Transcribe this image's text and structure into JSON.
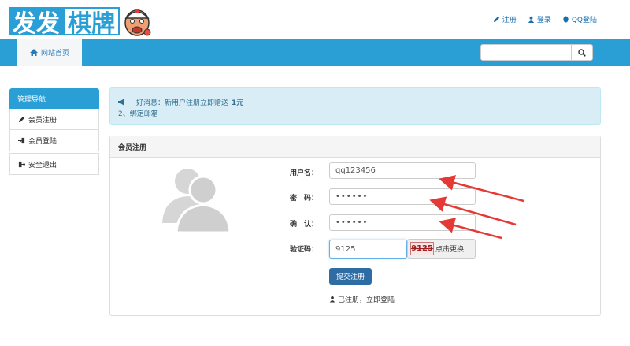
{
  "header": {
    "logo_text_1": "发发",
    "logo_text_2": "棋牌",
    "links": {
      "register": "注册",
      "login": "登录",
      "qq_login": "QQ登陆"
    }
  },
  "nav": {
    "home": "网站首页",
    "search_placeholder": ""
  },
  "sidebar": {
    "title": "管理导航",
    "items": [
      "会员注册",
      "会员登陆",
      "安全退出"
    ]
  },
  "notice": {
    "line1_prefix": "好消息：新用户注册立即赠送",
    "line1_bold": "1元",
    "line2": "2、绑定邮箱"
  },
  "panel": {
    "title": "会员注册",
    "username_label": "用户名：",
    "username_value": "qq123456",
    "password_label": "密　码：",
    "password_value": "••••••",
    "confirm_label": "确　认：",
    "confirm_value": "••••••",
    "captcha_label": "验证码：",
    "captcha_value": "9125",
    "captcha_image_text": "9125",
    "captcha_refresh": "点击更换",
    "submit": "提交注册",
    "login_link": "已注册，立即登陆"
  },
  "colors": {
    "accent": "#2a9fd6",
    "button": "#2e6da4",
    "arrow": "#e53935"
  }
}
